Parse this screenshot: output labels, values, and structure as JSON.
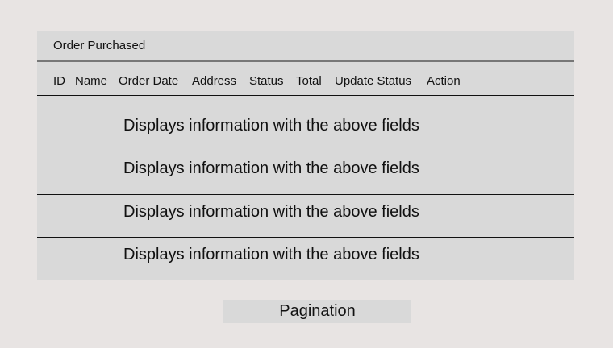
{
  "table": {
    "title": "Order Purchased",
    "columns": [
      "ID",
      "Name",
      "Order Date",
      "Address",
      "Status",
      "Total",
      "Update Status",
      "Action"
    ],
    "rows": [
      "Displays information with the above fields",
      "Displays information with the above fields",
      "Displays information with the above fields",
      "Displays information with the above fields"
    ]
  },
  "pagination": {
    "label": "Pagination"
  }
}
